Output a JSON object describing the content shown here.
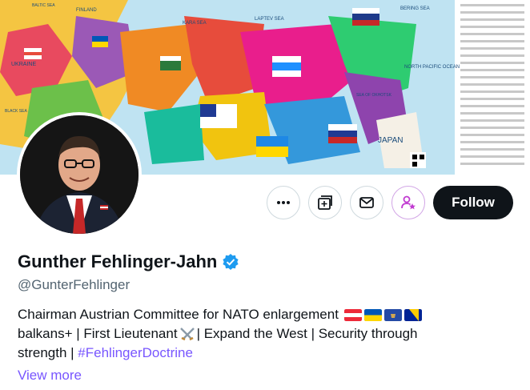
{
  "banner": {
    "labels": {
      "baltic_sea": "BALTIC SEA",
      "finland": "FINLAND",
      "kara_sea": "KARA SEA",
      "laptev_sea": "LAPTEV SEA",
      "bering_sea": "BERING SEA",
      "ukraine": "UKRAINE",
      "north_pacific": "NORTH PACIFIC OCEAN",
      "sea_of_okhotsk": "SEA OF OKHOTSK",
      "japan": "JAPAN",
      "black_sea": "BLACK SEA"
    }
  },
  "profile": {
    "display_name": "Gunther Fehlinger-Jahn",
    "handle": "@GunterFehlinger",
    "bio_line1": "Chairman Austrian Committee for NATO enlargement",
    "bio_line2": "balkans+ | First Lieutenant",
    "bio_line2_rest": "| Expand the West | Security through",
    "bio_line3": "strength | ",
    "hashtag": "#FehlingerDoctrine",
    "view_more": "View more"
  },
  "actions": {
    "follow_label": "Follow",
    "more_icon": "more-icon",
    "grok_icon": "grok-icon",
    "message_icon": "message-icon",
    "subscribe_icon": "subscribe-icon"
  },
  "colors": {
    "accent": "#7856ff",
    "verified": "#1d9bf0",
    "follow_bg": "#0f1419"
  }
}
